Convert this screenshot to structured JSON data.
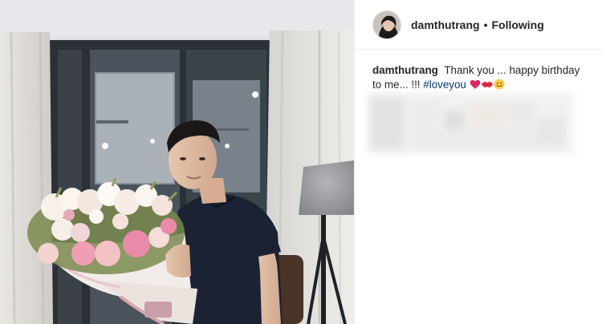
{
  "post": {
    "username": "damthutrang",
    "separator": "•",
    "follow_state": "Following"
  },
  "caption": {
    "username": "damthutrang",
    "text": "Thank you ... happy birthday to me... !!!",
    "hashtag": "#loveyou"
  },
  "colors": {
    "hashtag": "#003569",
    "text": "#262626",
    "divider": "#efefef"
  },
  "icons": [
    "heart-emoji",
    "kiss-emoji",
    "smile-emoji"
  ]
}
